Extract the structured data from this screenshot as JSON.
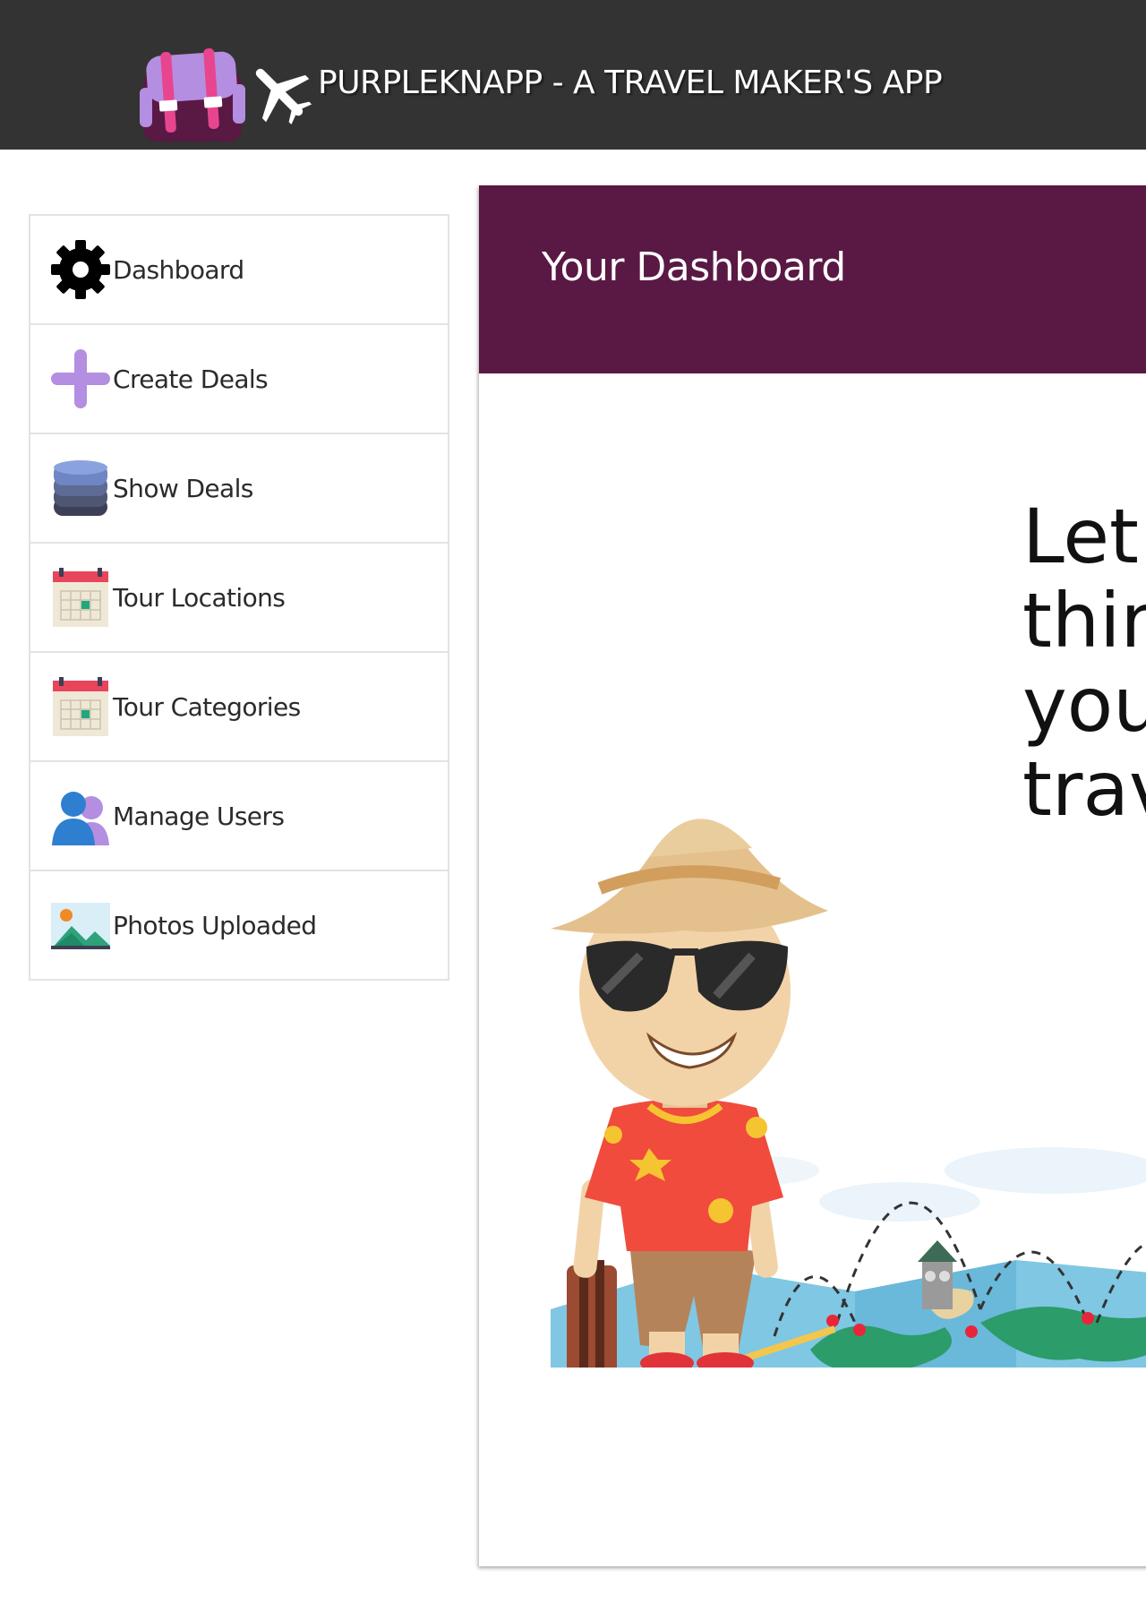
{
  "header": {
    "title": "PURPLEKNAPP - A TRAVEL MAKER'S APP",
    "logo_icons": [
      "backpack-icon",
      "airplane-icon"
    ]
  },
  "sidebar": {
    "items": [
      {
        "label": "Dashboard",
        "icon": "gear-icon"
      },
      {
        "label": "Create Deals",
        "icon": "plus-icon"
      },
      {
        "label": "Show Deals",
        "icon": "database-icon"
      },
      {
        "label": "Tour Locations",
        "icon": "calendar-icon"
      },
      {
        "label": "Tour Categories",
        "icon": "calendar-icon"
      },
      {
        "label": "Manage Users",
        "icon": "users-icon"
      },
      {
        "label": "Photos Uploaded",
        "icon": "image-icon"
      }
    ]
  },
  "main": {
    "title": "Your Dashboard",
    "tagline_lines": [
      "Let'",
      "thin",
      "you",
      "trav"
    ]
  },
  "colors": {
    "topbar": "#333333",
    "panel_header": "#5a1844",
    "accent_purple": "#b48ee0"
  }
}
